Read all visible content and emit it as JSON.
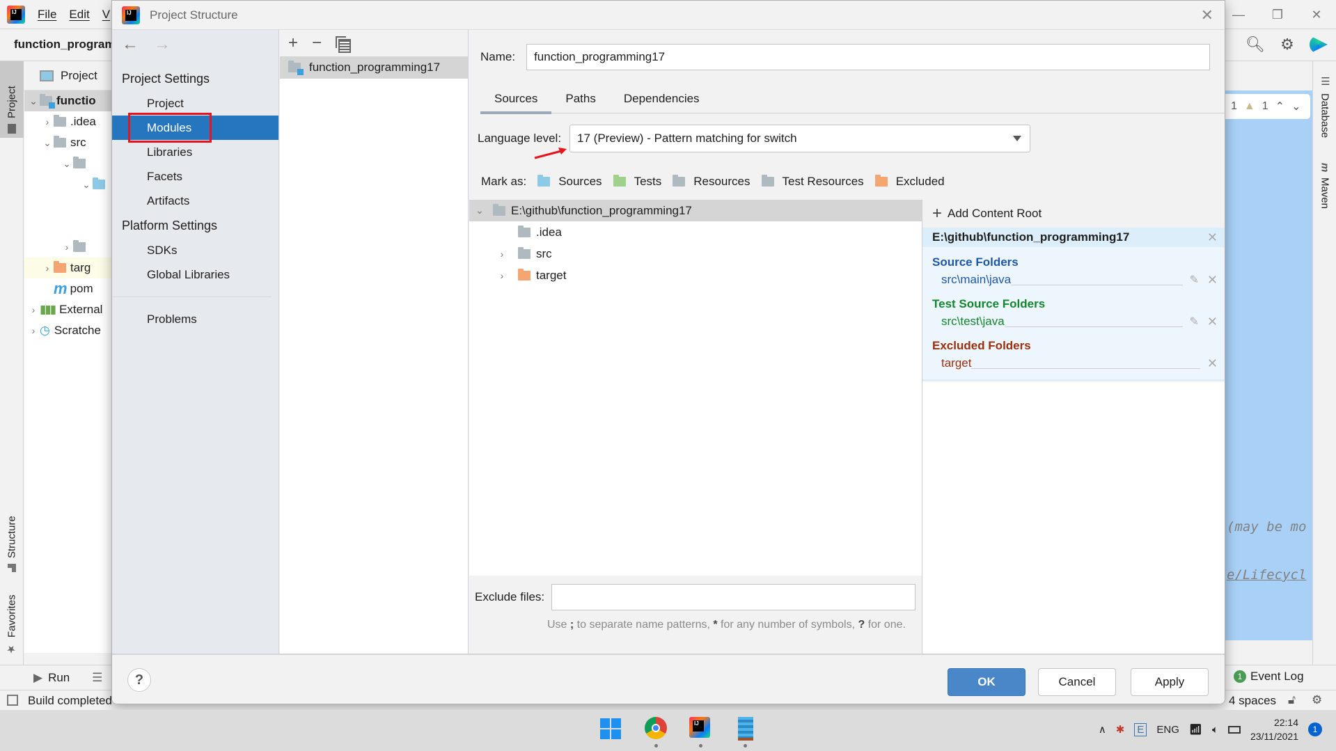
{
  "ide": {
    "menu": [
      "File",
      "Edit",
      "V"
    ],
    "project_title": "function_program",
    "project_view_label": "Project",
    "left_stripe": [
      "Project",
      "Structure",
      "Favorites"
    ],
    "right_stripe": [
      "Database",
      "Maven"
    ],
    "tree": [
      {
        "label": "functio",
        "bold": true
      },
      {
        "label": ".idea"
      },
      {
        "label": "src"
      },
      {
        "label": ""
      },
      {
        "label": ""
      },
      {
        "label": ""
      },
      {
        "label": "targ"
      },
      {
        "label": "pom"
      },
      {
        "label": "External"
      },
      {
        "label": "Scratche"
      }
    ],
    "inspection": {
      "errors": "1",
      "warnings": "1"
    },
    "code_lines": [
      "(may be mo",
      "e/Lifecycl"
    ],
    "bottom_tabs": {
      "run": "Run"
    },
    "status": {
      "message": "Build completed",
      "indent": "4 spaces",
      "event_log": "Event Log",
      "event_count": "1"
    }
  },
  "dialog": {
    "title": "Project Structure",
    "nav": {
      "project_settings_heading": "Project Settings",
      "project_settings_items": [
        "Project",
        "Modules",
        "Libraries",
        "Facets",
        "Artifacts"
      ],
      "selected": "Modules",
      "platform_settings_heading": "Platform Settings",
      "platform_settings_items": [
        "SDKs",
        "Global Libraries"
      ],
      "problems": "Problems"
    },
    "modules": [
      "function_programming17"
    ],
    "name_label": "Name:",
    "name_value": "function_programming17",
    "tabs": [
      "Sources",
      "Paths",
      "Dependencies"
    ],
    "active_tab": "Sources",
    "language_level_label": "Language level:",
    "language_level_value": "17 (Preview) - Pattern matching for switch",
    "mark_as_label": "Mark as:",
    "mark_as": [
      {
        "label": "Sources",
        "color": "#8dcae6"
      },
      {
        "label": "Tests",
        "color": "#9fd18a"
      },
      {
        "label": "Resources",
        "color": "#aeb9c0"
      },
      {
        "label": "Test Resources",
        "color": "#aeb9c0"
      },
      {
        "label": "Excluded",
        "color": "#f4a572"
      }
    ],
    "tree": {
      "root": "E:\\github\\function_programming17",
      "children": [
        {
          "label": ".idea",
          "expandable": false,
          "type": "normal"
        },
        {
          "label": "src",
          "expandable": true,
          "type": "normal"
        },
        {
          "label": "target",
          "expandable": true,
          "type": "excluded"
        }
      ]
    },
    "content_roots": {
      "add_label": "Add Content Root",
      "root_path": "E:\\github\\function_programming17",
      "source_folders_title": "Source Folders",
      "source_folders": [
        "src\\main\\java"
      ],
      "test_source_folders_title": "Test Source Folders",
      "test_source_folders": [
        "src\\test\\java"
      ],
      "excluded_folders_title": "Excluded Folders",
      "excluded_folders": [
        "target"
      ]
    },
    "exclude_files_label": "Exclude files:",
    "exclude_files_value": "",
    "exclude_hint_parts": [
      "Use ",
      ";",
      " to separate name patterns, ",
      "*",
      " for any number of symbols, ",
      "?",
      " for one."
    ],
    "buttons": {
      "ok": "OK",
      "cancel": "Cancel",
      "apply": "Apply",
      "help": "?"
    }
  },
  "taskbar": {
    "tray_lang": "ENG",
    "time": "22:14",
    "date": "23/11/2021",
    "notifications": "1"
  }
}
